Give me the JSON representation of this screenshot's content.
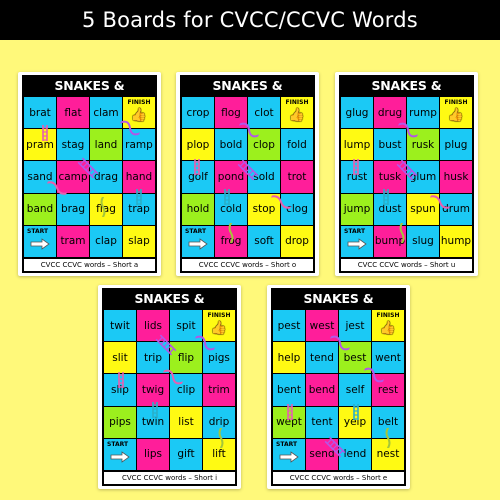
{
  "title": "5 Boards for CVCC/CCVC Words",
  "colors": {
    "background": "#FFF97A",
    "blue": "#1BC9F5",
    "pink": "#FF1E9A",
    "yellow": "#FFFA13",
    "green": "#9CF01D"
  },
  "boards": [
    {
      "heading": "SNAKES & LADDERS",
      "finish_label": "FINISH",
      "start_label": "START",
      "footer": "CVCC CCVC words – Short a",
      "rows": [
        [
          {
            "w": "brat",
            "c": "blue"
          },
          {
            "w": "flat",
            "c": "pink"
          },
          {
            "w": "clam",
            "c": "blue"
          },
          {
            "w": "",
            "c": "yellow",
            "finish": true
          }
        ],
        [
          {
            "w": "pram",
            "c": "yellow"
          },
          {
            "w": "stag",
            "c": "blue"
          },
          {
            "w": "land",
            "c": "green"
          },
          {
            "w": "ramp",
            "c": "blue"
          }
        ],
        [
          {
            "w": "sand",
            "c": "blue"
          },
          {
            "w": "camp",
            "c": "pink"
          },
          {
            "w": "drag",
            "c": "blue"
          },
          {
            "w": "hand",
            "c": "pink"
          }
        ],
        [
          {
            "w": "band",
            "c": "green"
          },
          {
            "w": "brag",
            "c": "blue"
          },
          {
            "w": "flag",
            "c": "yellow"
          },
          {
            "w": "trap",
            "c": "blue"
          }
        ],
        [
          {
            "w": "",
            "c": "blue",
            "start": true
          },
          {
            "w": "tram",
            "c": "pink"
          },
          {
            "w": "clap",
            "c": "blue"
          },
          {
            "w": "slap",
            "c": "yellow"
          }
        ]
      ]
    },
    {
      "heading": "SNAKES & LADDERS",
      "finish_label": "FINISH",
      "start_label": "START",
      "footer": "CVCC CCVC words – Short o",
      "rows": [
        [
          {
            "w": "crop",
            "c": "blue"
          },
          {
            "w": "flog",
            "c": "pink"
          },
          {
            "w": "clot",
            "c": "blue"
          },
          {
            "w": "",
            "c": "yellow",
            "finish": true
          }
        ],
        [
          {
            "w": "plop",
            "c": "yellow"
          },
          {
            "w": "bold",
            "c": "blue"
          },
          {
            "w": "clop",
            "c": "green"
          },
          {
            "w": "fold",
            "c": "blue"
          }
        ],
        [
          {
            "w": "golf",
            "c": "blue"
          },
          {
            "w": "pond",
            "c": "pink"
          },
          {
            "w": "sold",
            "c": "blue"
          },
          {
            "w": "trot",
            "c": "pink"
          }
        ],
        [
          {
            "w": "hold",
            "c": "green"
          },
          {
            "w": "cold",
            "c": "blue"
          },
          {
            "w": "stop",
            "c": "yellow"
          },
          {
            "w": "clog",
            "c": "blue"
          }
        ],
        [
          {
            "w": "",
            "c": "blue",
            "start": true
          },
          {
            "w": "frog",
            "c": "pink"
          },
          {
            "w": "soft",
            "c": "blue"
          },
          {
            "w": "drop",
            "c": "yellow"
          }
        ]
      ]
    },
    {
      "heading": "SNAKES & LADDERS",
      "finish_label": "FINISH",
      "start_label": "START",
      "footer": "CVCC CCVC words – Short u",
      "rows": [
        [
          {
            "w": "glug",
            "c": "blue"
          },
          {
            "w": "drug",
            "c": "pink"
          },
          {
            "w": "rump",
            "c": "blue"
          },
          {
            "w": "",
            "c": "yellow",
            "finish": true
          }
        ],
        [
          {
            "w": "lump",
            "c": "yellow"
          },
          {
            "w": "bust",
            "c": "blue"
          },
          {
            "w": "rusk",
            "c": "green"
          },
          {
            "w": "plug",
            "c": "blue"
          }
        ],
        [
          {
            "w": "rust",
            "c": "blue"
          },
          {
            "w": "tusk",
            "c": "pink"
          },
          {
            "w": "glum",
            "c": "blue"
          },
          {
            "w": "husk",
            "c": "pink"
          }
        ],
        [
          {
            "w": "jump",
            "c": "green"
          },
          {
            "w": "dust",
            "c": "blue"
          },
          {
            "w": "spun",
            "c": "yellow"
          },
          {
            "w": "drum",
            "c": "blue"
          }
        ],
        [
          {
            "w": "",
            "c": "blue",
            "start": true
          },
          {
            "w": "bump",
            "c": "pink"
          },
          {
            "w": "slug",
            "c": "blue"
          },
          {
            "w": "hump",
            "c": "yellow"
          }
        ]
      ]
    },
    {
      "heading": "SNAKES & LADDERS",
      "finish_label": "FINISH",
      "start_label": "START",
      "footer": "CVCC CCVC words – Short i",
      "rows": [
        [
          {
            "w": "twit",
            "c": "blue"
          },
          {
            "w": "lids",
            "c": "pink"
          },
          {
            "w": "spit",
            "c": "blue"
          },
          {
            "w": "",
            "c": "yellow",
            "finish": true
          }
        ],
        [
          {
            "w": "slit",
            "c": "yellow"
          },
          {
            "w": "trip",
            "c": "blue"
          },
          {
            "w": "flip",
            "c": "green"
          },
          {
            "w": "pigs",
            "c": "blue"
          }
        ],
        [
          {
            "w": "slip",
            "c": "blue"
          },
          {
            "w": "twig",
            "c": "pink"
          },
          {
            "w": "clip",
            "c": "blue"
          },
          {
            "w": "trim",
            "c": "pink"
          }
        ],
        [
          {
            "w": "pips",
            "c": "green"
          },
          {
            "w": "twin",
            "c": "blue"
          },
          {
            "w": "list",
            "c": "yellow"
          },
          {
            "w": "drip",
            "c": "blue"
          }
        ],
        [
          {
            "w": "",
            "c": "blue",
            "start": true
          },
          {
            "w": "lips",
            "c": "pink"
          },
          {
            "w": "gift",
            "c": "blue"
          },
          {
            "w": "lift",
            "c": "yellow"
          }
        ]
      ]
    },
    {
      "heading": "SNAKES & LADDERS",
      "finish_label": "FINISH",
      "start_label": "START",
      "footer": "CVCC CCVC words – Short e",
      "rows": [
        [
          {
            "w": "pest",
            "c": "blue"
          },
          {
            "w": "west",
            "c": "pink"
          },
          {
            "w": "jest",
            "c": "blue"
          },
          {
            "w": "",
            "c": "yellow",
            "finish": true
          }
        ],
        [
          {
            "w": "help",
            "c": "yellow"
          },
          {
            "w": "tend",
            "c": "blue"
          },
          {
            "w": "best",
            "c": "green"
          },
          {
            "w": "went",
            "c": "blue"
          }
        ],
        [
          {
            "w": "bent",
            "c": "blue"
          },
          {
            "w": "bend",
            "c": "pink"
          },
          {
            "w": "self",
            "c": "blue"
          },
          {
            "w": "rest",
            "c": "pink"
          }
        ],
        [
          {
            "w": "wept",
            "c": "green"
          },
          {
            "w": "tent",
            "c": "blue"
          },
          {
            "w": "yelp",
            "c": "yellow"
          },
          {
            "w": "belt",
            "c": "blue"
          }
        ],
        [
          {
            "w": "",
            "c": "blue",
            "start": true
          },
          {
            "w": "send",
            "c": "pink"
          },
          {
            "w": "lend",
            "c": "blue"
          },
          {
            "w": "nest",
            "c": "yellow"
          }
        ]
      ]
    }
  ]
}
